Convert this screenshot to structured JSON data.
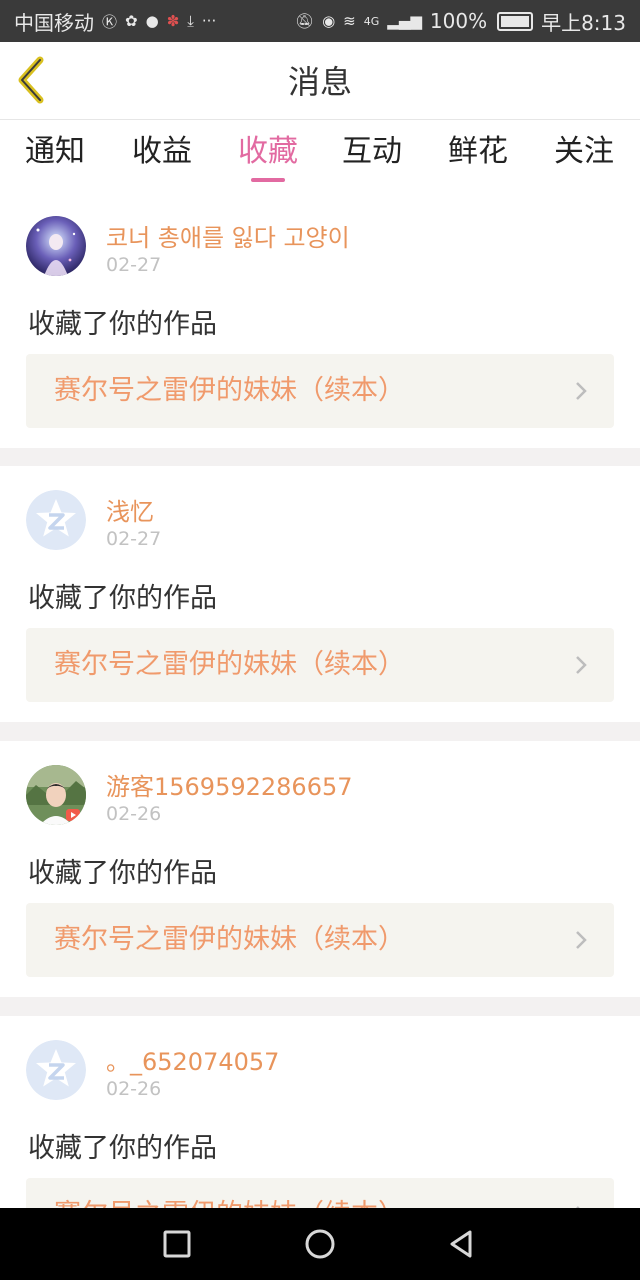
{
  "status_bar": {
    "carrier": "中国移动",
    "network": "4G",
    "battery": "100%",
    "time": "早上8:13"
  },
  "header": {
    "title": "消息"
  },
  "tabs": [
    {
      "label": "通知",
      "active": false
    },
    {
      "label": "收益",
      "active": false
    },
    {
      "label": "收藏",
      "active": true
    },
    {
      "label": "互动",
      "active": false
    },
    {
      "label": "鲜花",
      "active": false
    },
    {
      "label": "关注",
      "active": false
    }
  ],
  "messages": [
    {
      "username": "코너 총애를 잃다 고양이",
      "date": "02-27",
      "action": "收藏了你的作品",
      "work_title": "赛尔号之雷伊的妹妹（续本）",
      "avatar": "fantasy-avatar"
    },
    {
      "username": "浅忆",
      "date": "02-27",
      "action": "收藏了你的作品",
      "work_title": "赛尔号之雷伊的妹妹（续本）",
      "avatar": "default-z-avatar"
    },
    {
      "username": "游客1569592286657",
      "date": "02-26",
      "action": "收藏了你的作品",
      "work_title": "赛尔号之雷伊的妹妹（续本）",
      "avatar": "photo-avatar"
    },
    {
      "username": "。_652074057",
      "date": "02-26",
      "action": "收藏了你的作品",
      "work_title": "赛尔号之雷伊的妹妹（续本）",
      "avatar": "default-z-avatar"
    }
  ],
  "colors": {
    "accent_pink": "#e26aa1",
    "username_orange": "#e8945b",
    "work_title_orange": "#f09a6c"
  }
}
